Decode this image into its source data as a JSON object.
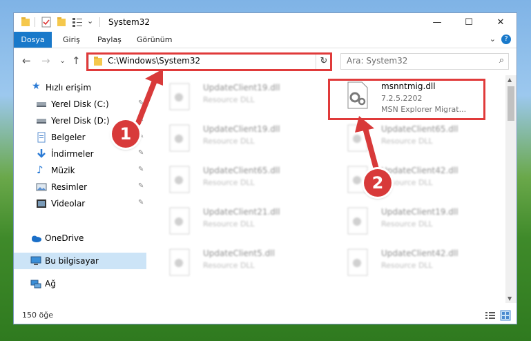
{
  "window": {
    "title": "System32",
    "minimize_glyph": "—",
    "maximize_glyph": "☐",
    "close_glyph": "✕"
  },
  "ribbon": {
    "tabs": [
      {
        "label": "Dosya",
        "active": true
      },
      {
        "label": "Giriş"
      },
      {
        "label": "Paylaş"
      },
      {
        "label": "Görünüm"
      }
    ],
    "help_glyph": "?",
    "expand_glyph": "⌄"
  },
  "nav": {
    "back_glyph": "←",
    "forward_glyph": "→",
    "recent_glyph": "⌄",
    "up_glyph": "↑",
    "address": "C:\\Windows\\System32",
    "dropdown_glyph": "⌄",
    "refresh_glyph": "↻",
    "search_placeholder": "Ara: System32",
    "search_glyph": "⌕"
  },
  "sidebar": {
    "items": [
      {
        "label": "Hızlı erişim",
        "icon": "star-icon"
      },
      {
        "label": "Yerel Disk (C:)",
        "icon": "drive-icon",
        "pinned": true
      },
      {
        "label": "Yerel Disk (D:)",
        "icon": "drive-icon",
        "pinned": true
      },
      {
        "label": "Belgeler",
        "icon": "document-icon",
        "pinned": true
      },
      {
        "label": "İndirmeler",
        "icon": "download-icon",
        "pinned": true
      },
      {
        "label": "Müzik",
        "icon": "music-icon",
        "pinned": true
      },
      {
        "label": "Resimler",
        "icon": "pictures-icon",
        "pinned": true
      },
      {
        "label": "Videolar",
        "icon": "video-icon",
        "pinned": true
      },
      {
        "label": "OneDrive",
        "icon": "cloud-icon"
      },
      {
        "label": "Bu bilgisayar",
        "icon": "computer-icon",
        "selected": true
      },
      {
        "label": "Ağ",
        "icon": "network-icon"
      }
    ],
    "pin_glyph": "✎"
  },
  "files": {
    "highlighted": {
      "name": "msnntmig.dll",
      "version": "7.2.5.2202",
      "description": "MSN Explorer Migrat..."
    },
    "left_column": [
      {
        "name": "UpdateClient19.dll",
        "type": "Resource DLL"
      },
      {
        "name": "UpdateClient19.dll",
        "type": "Resource DLL"
      },
      {
        "name": "UpdateClient65.dll",
        "type": "Resource DLL"
      },
      {
        "name": "UpdateClient21.dll",
        "type": "Resource DLL"
      },
      {
        "name": "UpdateClient5.dll",
        "type": "Resource DLL"
      }
    ],
    "right_column": [
      {
        "name": "UpdateClient65.dll",
        "type": "Resource DLL"
      },
      {
        "name": "UpdateClient42.dll",
        "type": "Resource DLL"
      },
      {
        "name": "UpdateClient19.dll",
        "type": "Resource DLL"
      },
      {
        "name": "UpdateClient42.dll",
        "type": "Resource DLL"
      }
    ]
  },
  "status": {
    "count": "150 öğe"
  },
  "annotations": {
    "badge1": "1",
    "badge2": "2",
    "color": "#e03a3a"
  }
}
